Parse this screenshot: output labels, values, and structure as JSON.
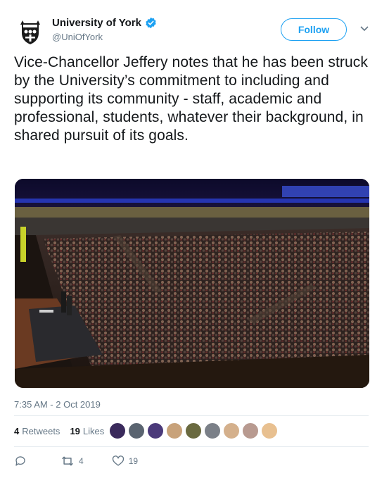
{
  "account": {
    "display_name": "University of York",
    "handle": "@UniOfYork",
    "verified": true
  },
  "follow_button": {
    "label": "Follow"
  },
  "tweet": {
    "text": "Vice-Chancellor Jeffery notes that he has been struck by the University’s commitment to including and supporting its community - staff, academic and professional, students, whatever their background, in shared pursuit of its goals.",
    "timestamp": "7:35 AM - 2 Oct 2019"
  },
  "stats": {
    "retweets_count": "4",
    "retweets_label": "Retweets",
    "likes_count": "19",
    "likes_label": "Likes"
  },
  "actions": {
    "retweet_count": "4",
    "like_count": "19"
  },
  "likers": [
    {
      "color": "#3a2a5c"
    },
    {
      "color": "#5a6470"
    },
    {
      "color": "#4b3a7a"
    },
    {
      "color": "#c8a27a"
    },
    {
      "color": "#6a6a40"
    },
    {
      "color": "#7b8088"
    },
    {
      "color": "#d4b08c"
    },
    {
      "color": "#b89a90"
    },
    {
      "color": "#e8c090"
    }
  ],
  "colors": {
    "accent": "#1da1f2",
    "secondary_text": "#657786"
  }
}
